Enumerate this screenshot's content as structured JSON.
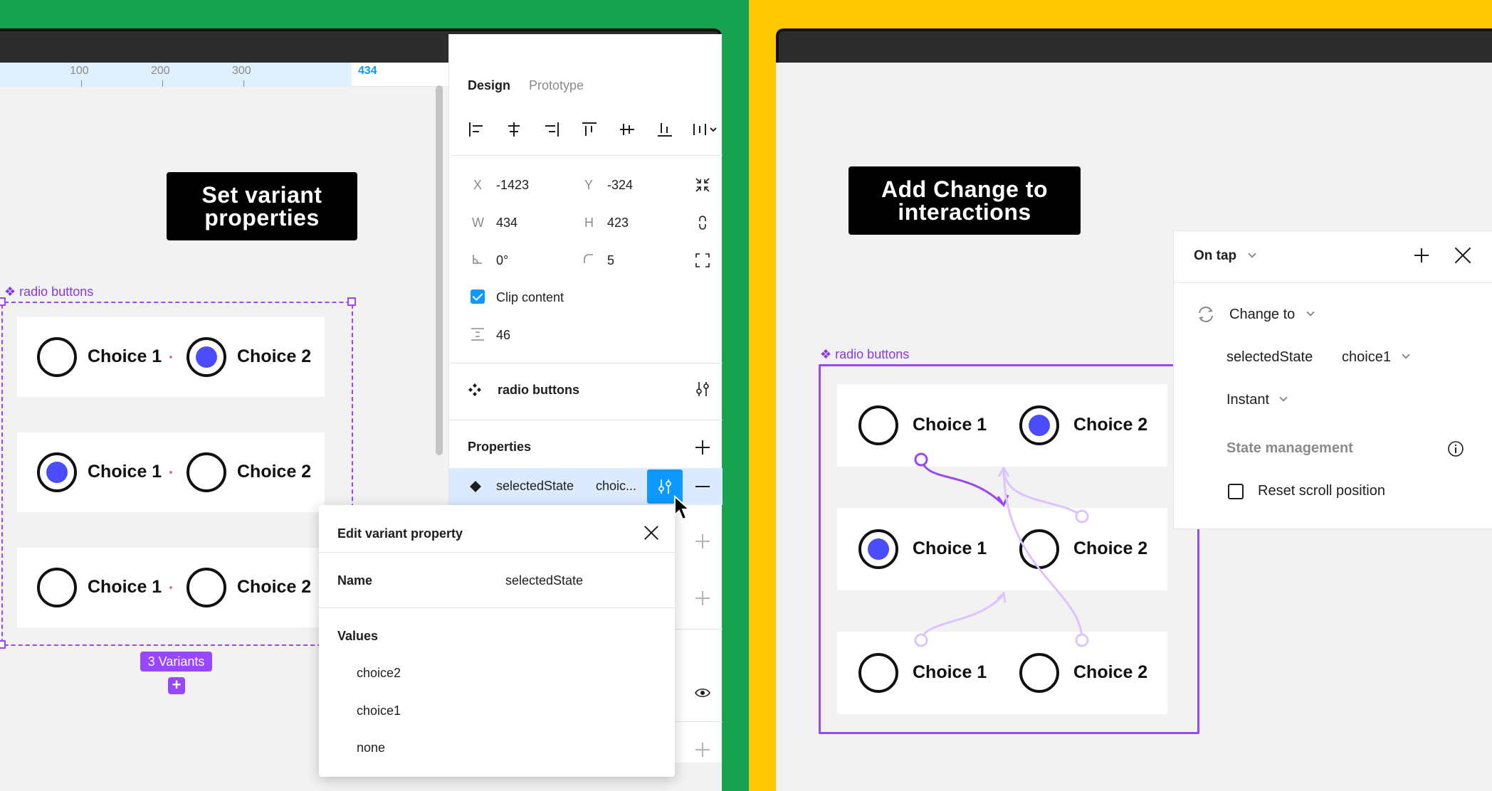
{
  "colors": {
    "left_bg": "#18a350",
    "right_bg": "#ffc700",
    "accent": "#9747ff",
    "radio_fill": "#4b4bff",
    "selection_blue": "#0d99ff"
  },
  "left": {
    "ruler": {
      "ticks": [
        "100",
        "200",
        "300"
      ],
      "selection_end": "434"
    },
    "callout": {
      "line1": "Set variant",
      "line2": "properties"
    },
    "component": {
      "label": "radio buttons",
      "variants_badge": "3 Variants",
      "add_icon": "plus-icon",
      "rows": [
        {
          "choice1": "Choice 1",
          "choice2": "Choice 2",
          "selected": "choice2"
        },
        {
          "choice1": "Choice 1",
          "choice2": "Choice 2",
          "selected": "choice1"
        },
        {
          "choice1": "Choice 1",
          "choice2": "Choice 2",
          "selected": "none"
        }
      ]
    },
    "panel": {
      "tabs": [
        "Design",
        "Prototype"
      ],
      "fields": {
        "x_label": "X",
        "x_value": "-1423",
        "y_label": "Y",
        "y_value": "-324",
        "w_label": "W",
        "w_value": "434",
        "h_label": "H",
        "h_value": "423",
        "rotation": "0°",
        "radius": "5",
        "clip_label": "Clip content",
        "clip_checked": true,
        "spacing": "46"
      },
      "component_name": "radio buttons",
      "properties_title": "Properties",
      "property": {
        "name": "selectedState",
        "value": "choic..."
      }
    },
    "popup": {
      "title": "Edit variant property",
      "name_label": "Name",
      "name_value": "selectedState",
      "values_label": "Values",
      "values": [
        "choice2",
        "choice1",
        "none"
      ]
    }
  },
  "right": {
    "callout": {
      "line1": "Add Change to",
      "line2": "interactions"
    },
    "component": {
      "label": "radio buttons",
      "rows": [
        {
          "choice1": "Choice 1",
          "choice2": "Choice 2",
          "selected": "choice2"
        },
        {
          "choice1": "Choice 1",
          "choice2": "Choice 2",
          "selected": "choice1"
        },
        {
          "choice1": "Choice 1",
          "choice2": "Choice 2",
          "selected": "none"
        }
      ]
    },
    "interaction": {
      "trigger": "On tap",
      "action": "Change to",
      "property_name": "selectedState",
      "property_value": "choice1",
      "animation": "Instant",
      "state_management": "State management",
      "reset_scroll": "Reset scroll position",
      "reset_scroll_checked": false
    }
  }
}
